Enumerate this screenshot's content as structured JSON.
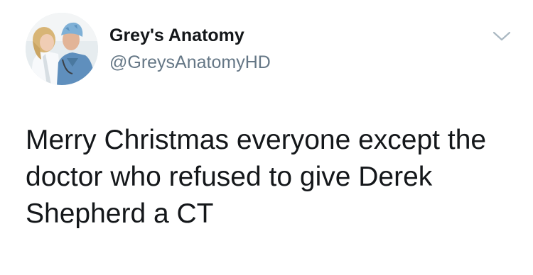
{
  "tweet": {
    "author": {
      "display_name": "Grey's Anatomy",
      "handle": "@GreysAnatomyHD",
      "avatar_icon": "profile-photo-icon"
    },
    "menu_icon": "chevron-down-icon",
    "text": "Merry Christmas everyone except the\ndoctor who refused to give Derek\nShepherd a CT"
  },
  "colors": {
    "background": "#ffffff",
    "name_text": "#14171a",
    "handle_text": "#657786",
    "caret": "#aab8c2"
  }
}
